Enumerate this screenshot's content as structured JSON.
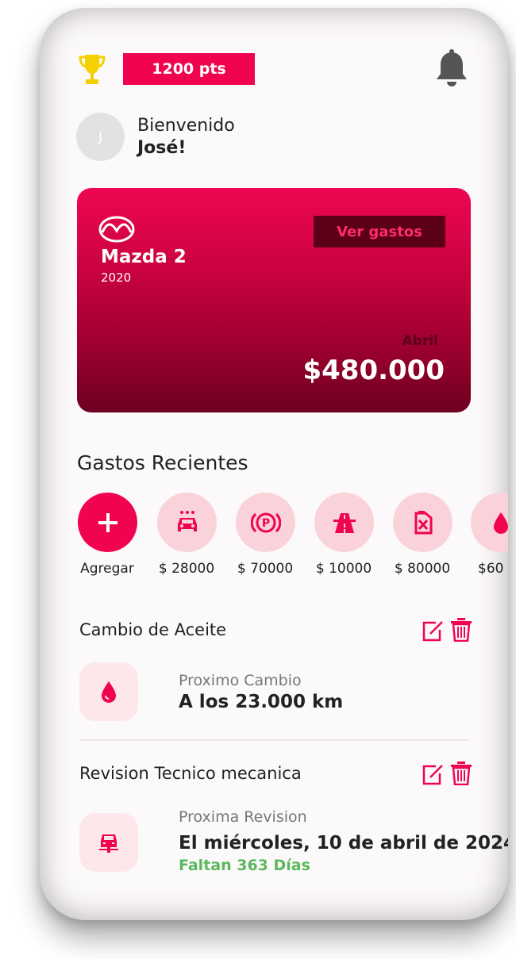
{
  "header": {
    "points": "1200 pts",
    "trophy_icon": "trophy-icon",
    "bell_icon": "bell-icon"
  },
  "user": {
    "avatar_initial": "J",
    "greeting": "Bienvenido",
    "name": "José!"
  },
  "car_card": {
    "brand_icon": "mazda-logo-icon",
    "model": "Mazda 2",
    "year": "2020",
    "button_label": "Ver gastos",
    "month": "Abril",
    "amount": "$480.000"
  },
  "recent_expenses": {
    "title": "Gastos Recientes",
    "items": [
      {
        "label": "Agregar",
        "icon": "plus-icon"
      },
      {
        "label": "$ 28000",
        "icon": "car-wash-icon"
      },
      {
        "label": "$ 70000",
        "icon": "parking-icon"
      },
      {
        "label": "$ 10000",
        "icon": "highway-icon"
      },
      {
        "label": "$ 80000",
        "icon": "fuel-can-icon"
      },
      {
        "label": "$60",
        "icon": "oil-drop-icon"
      }
    ]
  },
  "maintenance": [
    {
      "title": "Cambio de Aceite",
      "icon": "oil-drop-icon",
      "subtitle": "Proximo Cambio",
      "main": "A los 23.000 km",
      "note": ""
    },
    {
      "title": "Revision Tecnico mecanica",
      "icon": "car-inspection-icon",
      "subtitle": "Proxima Revision",
      "main": "El miércoles, 10 de abril de 2024",
      "note": "Faltan 363 Días"
    }
  ],
  "colors": {
    "accent": "#f0044f",
    "accent_light": "#f9d2da",
    "card_dark": "#6d0020",
    "success": "#5cb85c",
    "trophy": "#f5d000"
  }
}
